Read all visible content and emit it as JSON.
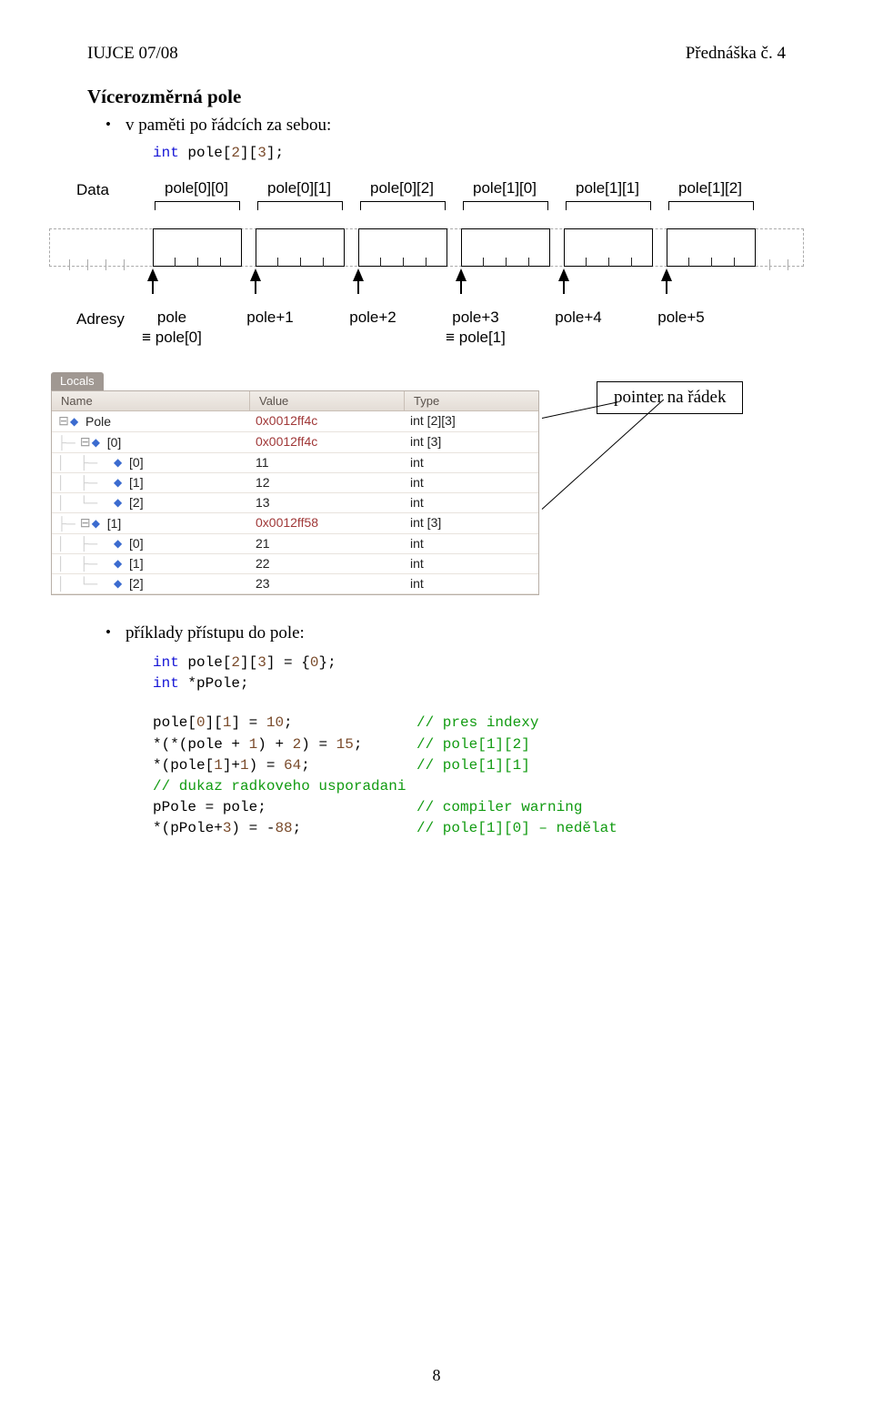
{
  "header": {
    "left": "IUJCE 07/08",
    "right": "Přednáška č. 4"
  },
  "section_title": "Vícerozměrná pole",
  "bullets": {
    "b1": "v paměti po řádcích za sebou:",
    "b2": "příklady přístupu do pole:"
  },
  "decl1_html": "<span class='kw'>int</span> pole[<span class='num'>2</span>][<span class='num'>3</span>];",
  "diagram": {
    "data_label": "Data",
    "addr_label": "Adresy",
    "indices": [
      "pole[0][0]",
      "pole[0][1]",
      "pole[0][2]",
      "pole[1][0]",
      "pole[1][1]",
      "pole[1][2]"
    ],
    "addrs": [
      {
        "line1": "pole",
        "line2": "≡ pole[0]"
      },
      {
        "line1": "pole+1",
        "line2": ""
      },
      {
        "line1": "pole+2",
        "line2": ""
      },
      {
        "line1": "pole+3",
        "line2": "≡ pole[1]"
      },
      {
        "line1": "pole+4",
        "line2": ""
      },
      {
        "line1": "pole+5",
        "line2": ""
      }
    ]
  },
  "pointer_note": "pointer na řádek",
  "debugger": {
    "tab": "Locals",
    "cols": {
      "name": "Name",
      "value": "Value",
      "type": "Type"
    },
    "rows": [
      {
        "depth": 0,
        "tw": "⊟",
        "icon": "◆",
        "name": "Pole",
        "value": "0x0012ff4c",
        "value_red": true,
        "type": "int [2][3]"
      },
      {
        "depth": 1,
        "tw": "⊟",
        "icon": "◆",
        "name": "[0]",
        "value": "0x0012ff4c",
        "value_red": true,
        "type": "int [3]"
      },
      {
        "depth": 2,
        "tw": "",
        "icon": "◆",
        "name": "[0]",
        "value": "11",
        "type": "int"
      },
      {
        "depth": 2,
        "tw": "",
        "icon": "◆",
        "name": "[1]",
        "value": "12",
        "type": "int"
      },
      {
        "depth": 2,
        "tw": "",
        "icon": "◆",
        "name": "[2]",
        "value": "13",
        "type": "int"
      },
      {
        "depth": 1,
        "tw": "⊟",
        "icon": "◆",
        "name": "[1]",
        "value": "0x0012ff58",
        "value_red": true,
        "type": "int [3]"
      },
      {
        "depth": 2,
        "tw": "",
        "icon": "◆",
        "name": "[0]",
        "value": "21",
        "type": "int"
      },
      {
        "depth": 2,
        "tw": "",
        "icon": "◆",
        "name": "[1]",
        "value": "22",
        "type": "int"
      },
      {
        "depth": 2,
        "tw": "",
        "icon": "◆",
        "name": "[2]",
        "value": "23",
        "type": "int"
      }
    ]
  },
  "code": {
    "l1": "<span class='kw'>int</span> pole[<span class='num'>2</span>][<span class='num'>3</span>] = {<span class='num'>0</span>};",
    "l2": "<span class='kw'>int</span> *pPole;",
    "l3a": "pole[<span class='num'>0</span>][<span class='num'>1</span>] = <span class='num'>10</span>;",
    "l3b": "<span class='cm'>// pres indexy</span>",
    "l4a": "*(*(pole + <span class='num'>1</span>) + <span class='num'>2</span>) = <span class='num'>15</span>;",
    "l4b": "<span class='cm'>// pole[1][2]</span>",
    "l5a": "*(pole[<span class='num'>1</span>]+<span class='num'>1</span>) = <span class='num'>64</span>;",
    "l5b": "<span class='cm'>// pole[1][1]</span>",
    "l6": "<span class='cm'>// dukaz radkoveho usporadani</span>",
    "l7a": "pPole = pole;",
    "l7b": "<span class='cm'>// compiler warning</span>",
    "l8a": "*(pPole+<span class='num'>3</span>) = -<span class='num'>88</span>;",
    "l8b": "<span class='cm'>// pole[1][0] – nedělat</span>"
  },
  "pagenum": "8"
}
